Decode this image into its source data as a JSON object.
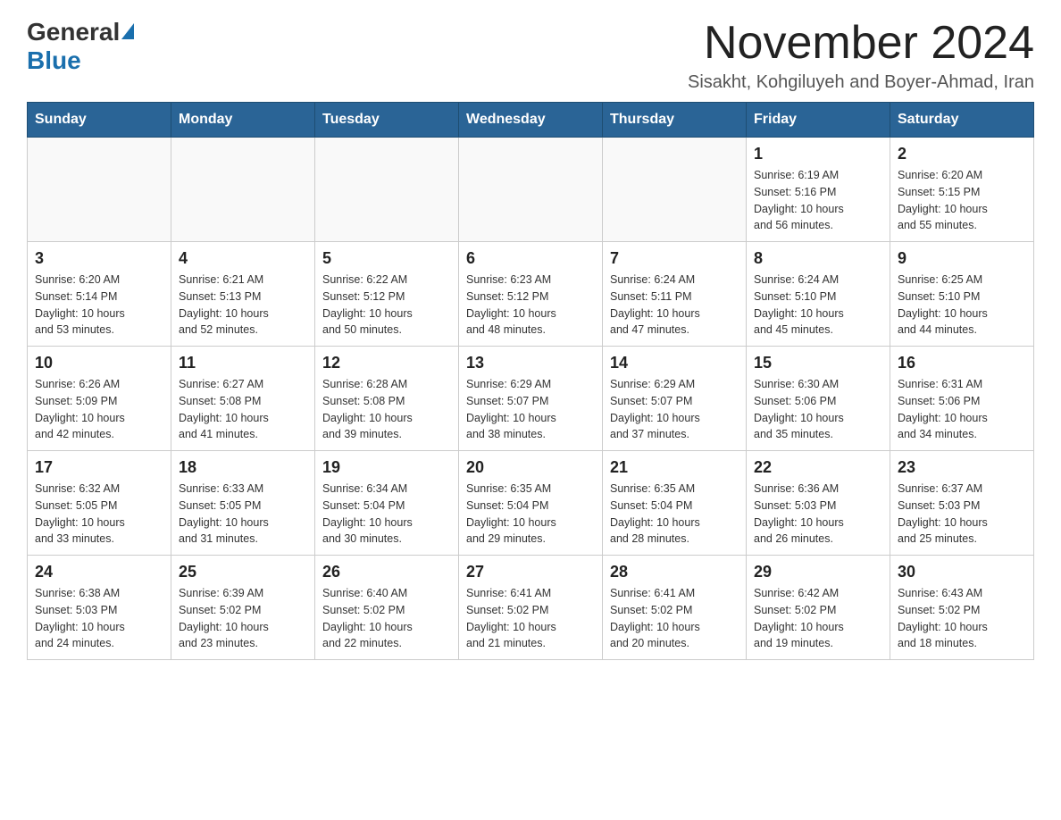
{
  "logo": {
    "general": "General",
    "blue": "Blue"
  },
  "header": {
    "month_title": "November 2024",
    "subtitle": "Sisakht, Kohgiluyeh and Boyer-Ahmad, Iran"
  },
  "days_of_week": [
    "Sunday",
    "Monday",
    "Tuesday",
    "Wednesday",
    "Thursday",
    "Friday",
    "Saturday"
  ],
  "weeks": [
    [
      {
        "day": "",
        "info": ""
      },
      {
        "day": "",
        "info": ""
      },
      {
        "day": "",
        "info": ""
      },
      {
        "day": "",
        "info": ""
      },
      {
        "day": "",
        "info": ""
      },
      {
        "day": "1",
        "info": "Sunrise: 6:19 AM\nSunset: 5:16 PM\nDaylight: 10 hours\nand 56 minutes."
      },
      {
        "day": "2",
        "info": "Sunrise: 6:20 AM\nSunset: 5:15 PM\nDaylight: 10 hours\nand 55 minutes."
      }
    ],
    [
      {
        "day": "3",
        "info": "Sunrise: 6:20 AM\nSunset: 5:14 PM\nDaylight: 10 hours\nand 53 minutes."
      },
      {
        "day": "4",
        "info": "Sunrise: 6:21 AM\nSunset: 5:13 PM\nDaylight: 10 hours\nand 52 minutes."
      },
      {
        "day": "5",
        "info": "Sunrise: 6:22 AM\nSunset: 5:12 PM\nDaylight: 10 hours\nand 50 minutes."
      },
      {
        "day": "6",
        "info": "Sunrise: 6:23 AM\nSunset: 5:12 PM\nDaylight: 10 hours\nand 48 minutes."
      },
      {
        "day": "7",
        "info": "Sunrise: 6:24 AM\nSunset: 5:11 PM\nDaylight: 10 hours\nand 47 minutes."
      },
      {
        "day": "8",
        "info": "Sunrise: 6:24 AM\nSunset: 5:10 PM\nDaylight: 10 hours\nand 45 minutes."
      },
      {
        "day": "9",
        "info": "Sunrise: 6:25 AM\nSunset: 5:10 PM\nDaylight: 10 hours\nand 44 minutes."
      }
    ],
    [
      {
        "day": "10",
        "info": "Sunrise: 6:26 AM\nSunset: 5:09 PM\nDaylight: 10 hours\nand 42 minutes."
      },
      {
        "day": "11",
        "info": "Sunrise: 6:27 AM\nSunset: 5:08 PM\nDaylight: 10 hours\nand 41 minutes."
      },
      {
        "day": "12",
        "info": "Sunrise: 6:28 AM\nSunset: 5:08 PM\nDaylight: 10 hours\nand 39 minutes."
      },
      {
        "day": "13",
        "info": "Sunrise: 6:29 AM\nSunset: 5:07 PM\nDaylight: 10 hours\nand 38 minutes."
      },
      {
        "day": "14",
        "info": "Sunrise: 6:29 AM\nSunset: 5:07 PM\nDaylight: 10 hours\nand 37 minutes."
      },
      {
        "day": "15",
        "info": "Sunrise: 6:30 AM\nSunset: 5:06 PM\nDaylight: 10 hours\nand 35 minutes."
      },
      {
        "day": "16",
        "info": "Sunrise: 6:31 AM\nSunset: 5:06 PM\nDaylight: 10 hours\nand 34 minutes."
      }
    ],
    [
      {
        "day": "17",
        "info": "Sunrise: 6:32 AM\nSunset: 5:05 PM\nDaylight: 10 hours\nand 33 minutes."
      },
      {
        "day": "18",
        "info": "Sunrise: 6:33 AM\nSunset: 5:05 PM\nDaylight: 10 hours\nand 31 minutes."
      },
      {
        "day": "19",
        "info": "Sunrise: 6:34 AM\nSunset: 5:04 PM\nDaylight: 10 hours\nand 30 minutes."
      },
      {
        "day": "20",
        "info": "Sunrise: 6:35 AM\nSunset: 5:04 PM\nDaylight: 10 hours\nand 29 minutes."
      },
      {
        "day": "21",
        "info": "Sunrise: 6:35 AM\nSunset: 5:04 PM\nDaylight: 10 hours\nand 28 minutes."
      },
      {
        "day": "22",
        "info": "Sunrise: 6:36 AM\nSunset: 5:03 PM\nDaylight: 10 hours\nand 26 minutes."
      },
      {
        "day": "23",
        "info": "Sunrise: 6:37 AM\nSunset: 5:03 PM\nDaylight: 10 hours\nand 25 minutes."
      }
    ],
    [
      {
        "day": "24",
        "info": "Sunrise: 6:38 AM\nSunset: 5:03 PM\nDaylight: 10 hours\nand 24 minutes."
      },
      {
        "day": "25",
        "info": "Sunrise: 6:39 AM\nSunset: 5:02 PM\nDaylight: 10 hours\nand 23 minutes."
      },
      {
        "day": "26",
        "info": "Sunrise: 6:40 AM\nSunset: 5:02 PM\nDaylight: 10 hours\nand 22 minutes."
      },
      {
        "day": "27",
        "info": "Sunrise: 6:41 AM\nSunset: 5:02 PM\nDaylight: 10 hours\nand 21 minutes."
      },
      {
        "day": "28",
        "info": "Sunrise: 6:41 AM\nSunset: 5:02 PM\nDaylight: 10 hours\nand 20 minutes."
      },
      {
        "day": "29",
        "info": "Sunrise: 6:42 AM\nSunset: 5:02 PM\nDaylight: 10 hours\nand 19 minutes."
      },
      {
        "day": "30",
        "info": "Sunrise: 6:43 AM\nSunset: 5:02 PM\nDaylight: 10 hours\nand 18 minutes."
      }
    ]
  ]
}
